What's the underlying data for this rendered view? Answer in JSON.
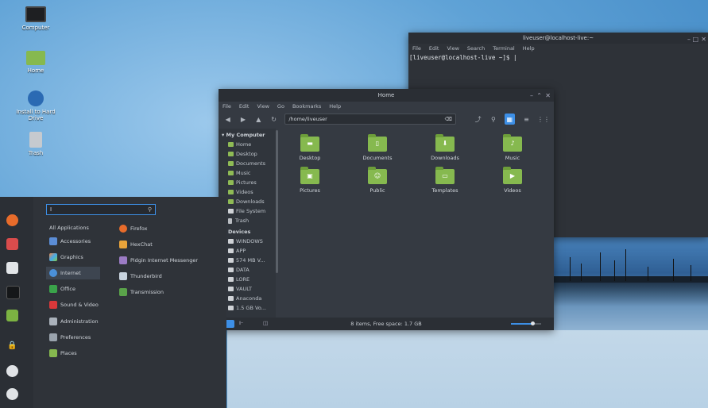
{
  "desktop": {
    "icons": [
      {
        "label": "Computer"
      },
      {
        "label": "Home"
      },
      {
        "label": "Install to Hard Drive"
      },
      {
        "label": "Trash"
      }
    ]
  },
  "terminal": {
    "title": "liveuser@localhost-live:~",
    "menu": [
      "File",
      "Edit",
      "View",
      "Search",
      "Terminal",
      "Help"
    ],
    "prompt": "[liveuser@localhost-live ~]$ |"
  },
  "file_manager": {
    "title": "Home",
    "menu": [
      "File",
      "Edit",
      "View",
      "Go",
      "Bookmarks",
      "Help"
    ],
    "path": "/home/liveuser",
    "sidebar": {
      "my_computer_heading": "My Computer",
      "places": [
        "Home",
        "Desktop",
        "Documents",
        "Music",
        "Pictures",
        "Videos",
        "Downloads",
        "File System",
        "Trash"
      ],
      "devices_heading": "Devices",
      "devices": [
        "WINDOWS",
        "APP",
        "574 MB V...",
        "DATA",
        "LORE",
        "VAULT",
        "Anaconda",
        "1.5 GB Vo..."
      ]
    },
    "files": [
      "Desktop",
      "Documents",
      "Downloads",
      "Music",
      "Pictures",
      "Public",
      "Templates",
      "Videos"
    ],
    "status": "8 items, Free space: 1.7 GB",
    "zoom_level": 0.7
  },
  "menu": {
    "search_value": "I",
    "categories": [
      "All Applications",
      "Accessories",
      "Graphics",
      "Internet",
      "Office",
      "Sound & Video",
      "Administration",
      "Preferences",
      "Places"
    ],
    "active_category": "Internet",
    "apps": [
      "Firefox",
      "HexChat",
      "Pidgin Internet Messenger",
      "Thunderbird",
      "Transmission"
    ]
  },
  "colors": {
    "accent": "#3d8fe6",
    "folder": "#86b94f",
    "panel": "#2f3339"
  }
}
